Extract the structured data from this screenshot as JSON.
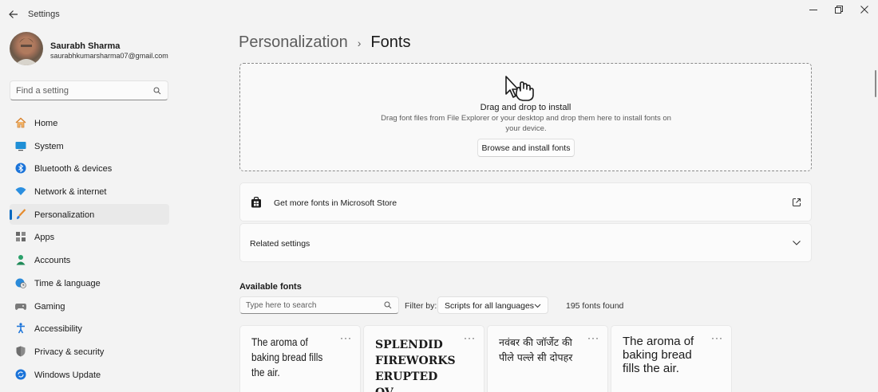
{
  "window": {
    "title": "Settings",
    "controls": [
      "minimize",
      "maximize",
      "close"
    ]
  },
  "profile": {
    "name": "Saurabh Sharma",
    "email": "saurabhkumarsharma07@gmail.com"
  },
  "search": {
    "placeholder": "Find a setting"
  },
  "nav": {
    "items": [
      {
        "label": "Home",
        "icon": "home-icon"
      },
      {
        "label": "System",
        "icon": "monitor-icon"
      },
      {
        "label": "Bluetooth & devices",
        "icon": "bluetooth-icon"
      },
      {
        "label": "Network & internet",
        "icon": "wifi-icon"
      },
      {
        "label": "Personalization",
        "icon": "brush-icon",
        "active": true
      },
      {
        "label": "Apps",
        "icon": "apps-icon"
      },
      {
        "label": "Accounts",
        "icon": "person-icon"
      },
      {
        "label": "Time & language",
        "icon": "globe-clock-icon"
      },
      {
        "label": "Gaming",
        "icon": "gamepad-icon"
      },
      {
        "label": "Accessibility",
        "icon": "accessibility-icon"
      },
      {
        "label": "Privacy & security",
        "icon": "shield-icon"
      },
      {
        "label": "Windows Update",
        "icon": "update-icon"
      }
    ]
  },
  "breadcrumb": {
    "parent": "Personalization",
    "separator": "›",
    "current": "Fonts"
  },
  "dropzone": {
    "title": "Drag and drop to install",
    "description": "Drag font files from File Explorer or your desktop and drop them here to install fonts on your device.",
    "button": "Browse and install fonts"
  },
  "store_card": {
    "label": "Get more fonts in Microsoft Store"
  },
  "related_card": {
    "label": "Related settings"
  },
  "available_fonts": {
    "title": "Available fonts",
    "search_placeholder": "Type here to search",
    "filter_label": "Filter by:",
    "filter_value": "Scripts for all languages",
    "count": "195 fonts found",
    "cards": [
      {
        "sample": "The aroma of baking bread fills the air.",
        "more": "···"
      },
      {
        "sample": "SPLENDID FIREWORKS ERUPTED OV...",
        "more": "···"
      },
      {
        "sample": "नवंबर की जॉर्जेट की पीले पल्ले सी दोपहर",
        "more": "···"
      },
      {
        "sample": "The aroma of baking bread fills the air.",
        "more": "···"
      }
    ]
  },
  "colors": {
    "accent": "#0067c0",
    "background": "#f3f3f3",
    "card": "#fbfbfb"
  }
}
